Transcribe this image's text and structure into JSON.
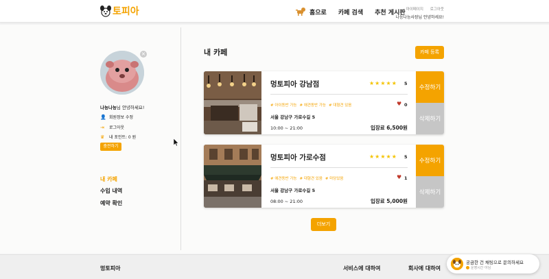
{
  "header": {
    "logo_text": "토피아",
    "nav": {
      "home": "홈으로",
      "cafe_search": "카페 검색",
      "board": "추천 게시판"
    },
    "util": {
      "mypage": "마이페이지",
      "logout": "로그아웃"
    },
    "greeting": "나능나능사장님 안녕하세요!"
  },
  "sidebar": {
    "username": "나능나능",
    "greeting_suffix": "님 안녕하세요!",
    "links": [
      {
        "label": "회원정보 수정",
        "icon": "user-icon"
      },
      {
        "label": "로그아웃",
        "icon": "logout-icon"
      },
      {
        "label": "내 포인트: 0 원",
        "icon": "crown-icon"
      }
    ],
    "charge_button": "충전하기",
    "menu": [
      {
        "label": "내 카페",
        "active": true
      },
      {
        "label": "수입 내역",
        "active": false
      },
      {
        "label": "예약 확인",
        "active": false
      }
    ]
  },
  "main": {
    "title": "내 카페",
    "register_button": "카페 등록",
    "cafes": [
      {
        "name": "멍토피아 강남점",
        "rating": "5",
        "stars": "★★★★★",
        "tags": [
          "# 아이동반 가능",
          "# 애견동반 가능",
          "# 대형견 있음"
        ],
        "likes": "0",
        "address": "서울 강남구 가로수길 5",
        "hours": "10:00 ~ 21:00",
        "fee": "입장료 6,500원",
        "edit": "수정하기",
        "delete": "삭제하기"
      },
      {
        "name": "멍토피아 가로수점",
        "rating": "5",
        "stars": "★★★★★",
        "tags": [
          "# 애견동반 가능",
          "# 대형견 있음",
          "# 마당있음"
        ],
        "likes": "1",
        "address": "서울 강남구 가로수길 5",
        "hours": "08:00 ~ 21:00",
        "fee": "입장료 5,000원",
        "edit": "수정하기",
        "delete": "삭제하기"
      }
    ],
    "more_button": "더보기"
  },
  "footer": {
    "brand": "멍토피아",
    "service": "서비스에 대하여",
    "company": "회사에 대하여"
  },
  "chat": {
    "question": "궁금한 건 채팅으로 문의하세요",
    "status": "운영시간 아님"
  },
  "colors": {
    "accent": "#f4a300",
    "delete": "#c6c6c6",
    "heart": "#c0392b"
  }
}
